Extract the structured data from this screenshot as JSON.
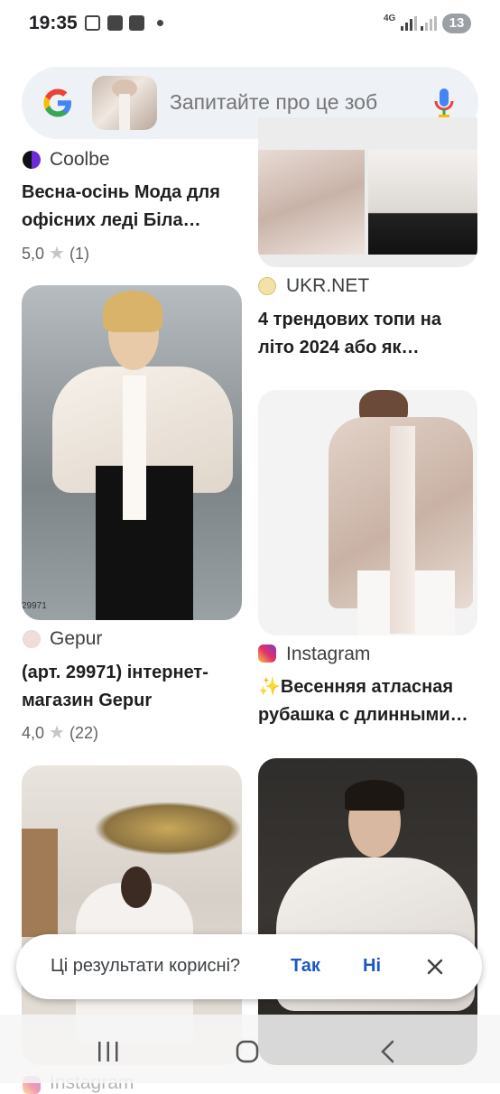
{
  "status_bar": {
    "time": "19:35",
    "network": "4G",
    "battery": "13"
  },
  "search": {
    "placeholder": "Запитайте про це зоб"
  },
  "results": [
    {
      "source": "Coolbe",
      "title": "Весна-осінь Мода для офісних леді Біла…",
      "rating": "5,0",
      "reviews": "(1)"
    },
    {
      "source": "UKR.NET",
      "title": "4 трендових топи на літо 2024 або як…"
    },
    {
      "source": "Gepur",
      "title": "(арт. 29971) інтернет-магазин Gepur",
      "rating": "4,0",
      "reviews": "(22)",
      "image_text": "29971"
    },
    {
      "source": "Instagram",
      "title": "✨Весенняя атласная рубашка с длинными…"
    },
    {
      "source": "Instagram"
    }
  ],
  "feedback": {
    "question": "Ці результати корисні?",
    "yes": "Так",
    "no": "Ні"
  },
  "nav": {
    "recents_icon": "recents-icon",
    "home_icon": "home-icon",
    "back_icon": "back-icon"
  },
  "colors": {
    "accent": "#1a57c9",
    "search_bg": "#eef1f6",
    "badge": "#9aa0a6"
  }
}
